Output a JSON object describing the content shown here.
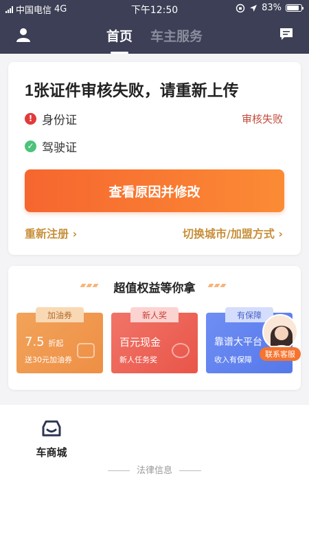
{
  "status_bar": {
    "carrier": "中国电信",
    "network": "4G",
    "time": "下午12:50",
    "battery": "83%",
    "battery_level": 0.83
  },
  "nav": {
    "tabs": [
      {
        "label": "首页",
        "active": true
      },
      {
        "label": "车主服务",
        "active": false
      }
    ],
    "icons": {
      "left": "user-icon",
      "right": "message-icon"
    }
  },
  "verification": {
    "headline": "1张证件审核失败，请重新上传",
    "items": [
      {
        "label": "身份证",
        "status_icon": "error-icon",
        "status_text": "审核失败"
      },
      {
        "label": "驾驶证",
        "status_icon": "check-icon",
        "status_text": ""
      }
    ],
    "action_button": "查看原因并修改",
    "link_left": "重新注册 ›",
    "link_right": "切换城市/加盟方式 ›"
  },
  "benefits": {
    "title": "超值权益等你拿",
    "coupons": [
      {
        "tag": "加油券",
        "main": "7.5",
        "main_suffix": "折起",
        "sub": "送30元加油券"
      },
      {
        "tag": "新人奖",
        "main": "百元现金",
        "main_suffix": "",
        "sub": "新人任务奖"
      },
      {
        "tag": "有保障",
        "main": "靠谱大平台",
        "main_suffix": "",
        "sub": "收入有保障"
      }
    ]
  },
  "customer_service": {
    "label": "联系客服"
  },
  "shortcuts": [
    {
      "label": "车商城",
      "icon": "car-icon"
    }
  ],
  "footer": {
    "legal": "法律信息"
  },
  "colors": {
    "header_bg": "#3c3f55",
    "primary_orange": "#f6662f",
    "link_gold": "#c78f3a",
    "fail_red": "#c14b3b"
  }
}
